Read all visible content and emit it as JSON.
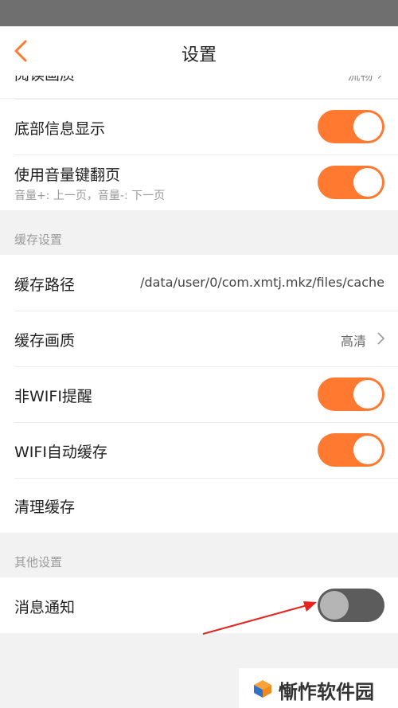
{
  "header": {
    "title": "设置"
  },
  "reading": {
    "partial_label": "阅读画质",
    "partial_value": "流畅 ›"
  },
  "display": {
    "bottom_info": {
      "label": "底部信息显示",
      "enabled": true
    },
    "volume_flip": {
      "label": "使用音量键翻页",
      "sub": "音量+: 上一页，音量-: 下一页",
      "enabled": true
    }
  },
  "cache": {
    "section_title": "缓存设置",
    "path_label": "缓存路径",
    "path_value": "/data/user/0/com.xmtj.mkz/files/cache",
    "quality_label": "缓存画质",
    "quality_value": "高清",
    "non_wifi_label": "非WIFI提醒",
    "non_wifi_enabled": true,
    "wifi_auto_label": "WIFI自动缓存",
    "wifi_auto_enabled": true,
    "clear_label": "清理缓存"
  },
  "other": {
    "section_title": "其他设置",
    "notification_label": "消息通知",
    "notification_enabled": false
  },
  "watermark": {
    "text": "慚怍软件园"
  },
  "colors": {
    "accent": "#ff7a30",
    "toggle_off": "#5c5c5c",
    "arrow": "#e8231e"
  }
}
